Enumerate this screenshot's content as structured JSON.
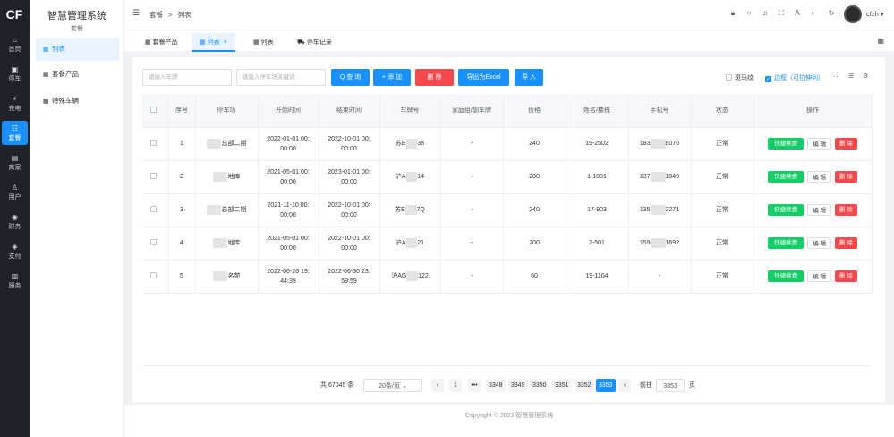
{
  "app": {
    "logo": "CF",
    "title": "智慧管理系统",
    "subtitle": "套餐"
  },
  "rail": [
    {
      "label": "首页",
      "icon": "home-icon",
      "glyph": "⌂"
    },
    {
      "label": "停车",
      "icon": "parking-icon",
      "glyph": "▣"
    },
    {
      "label": "充电",
      "icon": "charging-icon",
      "glyph": "⚡"
    },
    {
      "label": "套餐",
      "icon": "package-icon",
      "glyph": "☷"
    },
    {
      "label": "商家",
      "icon": "store-icon",
      "glyph": "▤"
    },
    {
      "label": "用户",
      "icon": "user-icon",
      "glyph": "♙"
    },
    {
      "label": "财务",
      "icon": "finance-icon",
      "glyph": "◉"
    },
    {
      "label": "支付",
      "icon": "payment-icon",
      "glyph": "◈"
    },
    {
      "label": "服务",
      "icon": "service-icon",
      "glyph": "▥"
    }
  ],
  "submenu": [
    {
      "label": "列表"
    },
    {
      "label": "套餐产品"
    },
    {
      "label": "特殊车辆"
    }
  ],
  "breadcrumb": [
    "套餐",
    ">",
    "列表"
  ],
  "user": {
    "name": "cfzh ▾"
  },
  "tabs": [
    {
      "label": "套餐产品"
    },
    {
      "label": "列表",
      "close": "×"
    },
    {
      "label": "列表"
    },
    {
      "label": "停车记录"
    }
  ],
  "search": {
    "plate_placeholder": "请输入车牌",
    "lot_placeholder": "请输入停车场关键词"
  },
  "toolbar": {
    "query": "Q 查 询",
    "add": "+ 添 加",
    "delete": "删 除",
    "export": "导出为Excel",
    "import": "导 入",
    "zebra": "斑马纹",
    "border": "边框（可拉伸列）"
  },
  "table": {
    "columns": [
      "",
      "序号",
      "停车场",
      "开始时间",
      "结束时间",
      "车牌号",
      "家庭组/副车牌",
      "价格",
      "姓名/楼栋",
      "手机号",
      "状态",
      "操作"
    ],
    "rows": [
      {
        "no": "1",
        "lot_a": "■■■■",
        "lot_b": "总部二期",
        "start_a": "2022-01-01 00:",
        "start_b": "00:00",
        "end_a": "2022-10-01 00:",
        "end_b": "00:00",
        "plate_a": "苏E",
        "plate_b": "38",
        "family": "-",
        "price": "240",
        "name": "19-2502",
        "phone_a": "183",
        "phone_b": "8070",
        "status": "正常"
      },
      {
        "no": "2",
        "lot_a": "■■■■",
        "lot_b": "地库",
        "start_a": "2021-05-01 00:",
        "start_b": "00:00",
        "end_a": "2023-01-01 00:",
        "end_b": "00:00",
        "plate_a": "沪A",
        "plate_b": "14",
        "family": "-",
        "price": "200",
        "name": "1-1001",
        "phone_a": "137",
        "phone_b": "1849",
        "status": "正常"
      },
      {
        "no": "3",
        "lot_a": "■■■■",
        "lot_b": "总部二期",
        "start_a": "2021-11-10 00:",
        "start_b": "00:00",
        "end_a": "2022-10-01 00:",
        "end_b": "00:00",
        "plate_a": "苏E",
        "plate_b": "7Q",
        "family": "-",
        "price": "240",
        "name": "17-903",
        "phone_a": "135",
        "phone_b": "2271",
        "status": "正常"
      },
      {
        "no": "4",
        "lot_a": "■■■■",
        "lot_b": "地库",
        "start_a": "2021-05-01 00:",
        "start_b": "00:00",
        "end_a": "2022-10-01 00:",
        "end_b": "00:00",
        "plate_a": "沪A",
        "plate_b": "21",
        "family": "-",
        "price": "200",
        "name": "2-501",
        "phone_a": "159",
        "phone_b": "1692",
        "status": "正常"
      },
      {
        "no": "5",
        "lot_a": "■■■■",
        "lot_b": "名苑",
        "start_a": "2022-06-26 19:",
        "start_b": "44:39",
        "end_a": "2022-06-30 23:",
        "end_b": "59:59",
        "plate_a": "沪AG",
        "plate_b": "122",
        "family": "-",
        "price": "60",
        "name": "19-1104",
        "phone_a": "-",
        "phone_b": "",
        "status": "正常"
      }
    ],
    "actions": {
      "renew": "快捷续费",
      "edit": "编 辑",
      "delete": "删 除"
    }
  },
  "pager": {
    "total": "共 67045 条",
    "size": "20条/页",
    "pages": [
      "1",
      "•••",
      "3348",
      "3349",
      "3350",
      "3351",
      "3352",
      "3353"
    ],
    "current": "3353",
    "prev": "‹",
    "next": "›",
    "goto": "前往",
    "goto_value": "3353",
    "goto_unit": "页"
  },
  "footer": {
    "copyright": "Copyright © 2022 智慧管理系统"
  },
  "colors": {
    "accent": "#1890ff",
    "danger": "#f5484d",
    "success": "#13ce66",
    "rail": "#1f2329"
  }
}
